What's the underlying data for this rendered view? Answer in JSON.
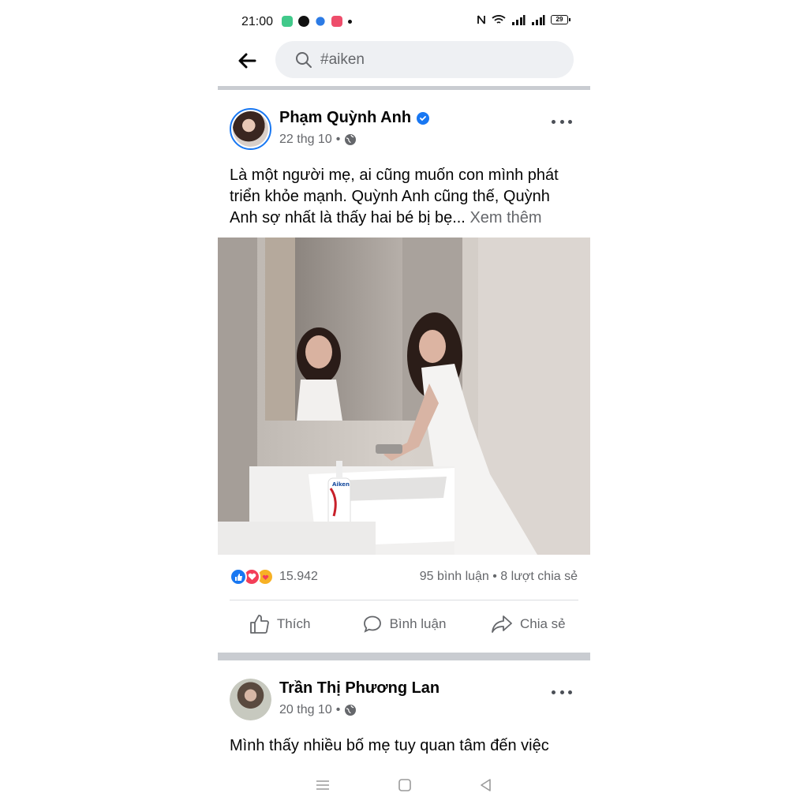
{
  "status_bar": {
    "time": "21:00",
    "battery": "29",
    "app_icons": [
      "messages-icon",
      "facebook-icon",
      "messenger-icon",
      "app-icon",
      "dot-icon"
    ]
  },
  "search": {
    "query": "#aiken"
  },
  "posts": [
    {
      "author": "Phạm Quỳnh Anh",
      "verified": true,
      "date": "22 thg 10",
      "privacy_separator": "•",
      "text": "Là một người mẹ, ai cũng muốn con mình phát triển khỏe mạnh. Quỳnh Anh cũng thế, Quỳnh Anh sợ nhất là thấy hai bé bị bẹ...",
      "see_more": "Xem thêm",
      "reaction_count": "15.942",
      "stats": "95 bình luận • 8 lượt chia sẻ",
      "actions": {
        "like": "Thích",
        "comment": "Bình luận",
        "share": "Chia sẻ"
      },
      "product_label": "Aiken"
    },
    {
      "author": "Trần Thị Phương Lan",
      "date": "20 thg 10",
      "privacy_separator": "•",
      "text": "Mình thấy nhiều bố mẹ tuy quan tâm đến việc"
    }
  ],
  "colors": {
    "accent": "#1877f2",
    "separator": "#c9ccd1",
    "secondary_text": "#65676b",
    "search_bg": "#eef0f3"
  }
}
